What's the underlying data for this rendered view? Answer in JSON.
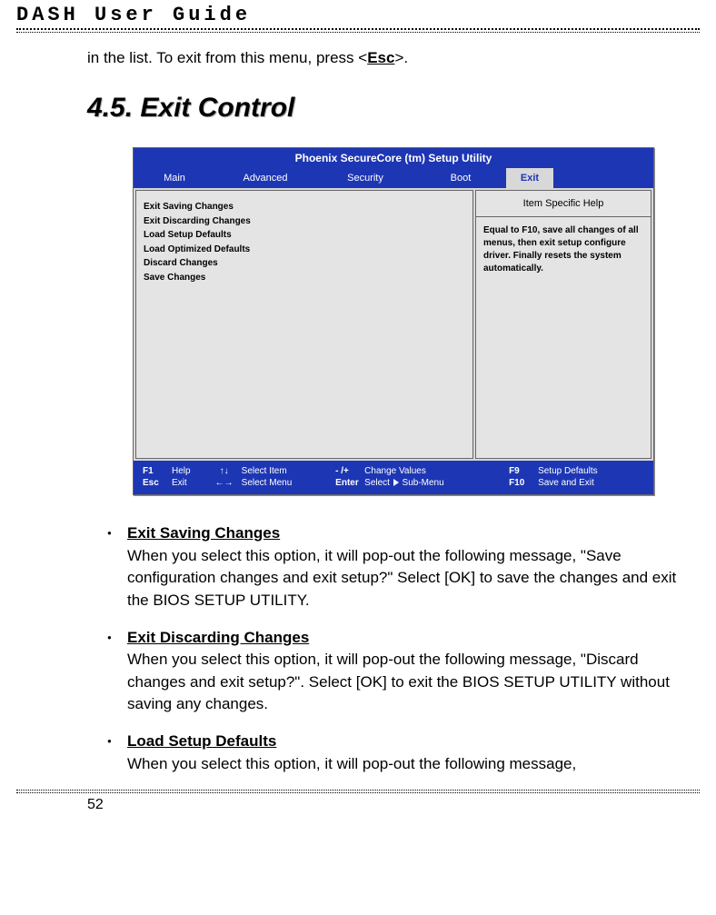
{
  "header": {
    "title": "DASH User Guide"
  },
  "intro": {
    "prefix": "in the list. To exit from this menu, press <",
    "key": "Esc",
    "suffix": ">."
  },
  "section_heading": "4.5. Exit Control",
  "bios": {
    "title": "Phoenix SecureCore (tm) Setup Utility",
    "tabs": {
      "main": "Main",
      "advanced": "Advanced",
      "security": "Security",
      "boot": "Boot",
      "exit": "Exit"
    },
    "left_items": [
      "Exit Saving Changes",
      "Exit Discarding Changes",
      "Load Setup Defaults",
      "Load Optimized Defaults",
      "Discard Changes",
      "Save Changes"
    ],
    "help_head": "Item Specific Help",
    "help_body": "Equal to F10, save all changes of all menus, then exit setup configure driver. Finally resets the system automatically.",
    "footer": {
      "r1": {
        "k1": "F1",
        "l1": "Help",
        "a1": "↑↓",
        "l2": "Select Item",
        "k2": "- /+",
        "l3": "Change Values",
        "k3": "F9",
        "l4": "Setup Defaults"
      },
      "r2": {
        "k1": "Esc",
        "l1": "Exit",
        "a1": "←→",
        "l2": "Select Menu",
        "k2": "Enter",
        "l3": "Select ▶ Sub-Menu",
        "l3a": "Select",
        "l3b": "Sub-Menu",
        "k3": "F10",
        "l4": "Save and Exit"
      }
    }
  },
  "options": [
    {
      "title": "Exit Saving Changes",
      "body": "When you select this option, it will pop-out the following message, \"Save configuration changes and exit setup?\" Select [OK] to save the changes and exit the BIOS SETUP UTILITY."
    },
    {
      "title": "Exit Discarding Changes",
      "body": "When you select this option, it will pop-out the following message, \"Discard changes and exit setup?\". Select [OK] to exit the BIOS SETUP UTILITY without saving any changes."
    },
    {
      "title": "Load Setup Defaults",
      "body": "When you select this option, it will pop-out the following message,"
    }
  ],
  "page_number": "52"
}
